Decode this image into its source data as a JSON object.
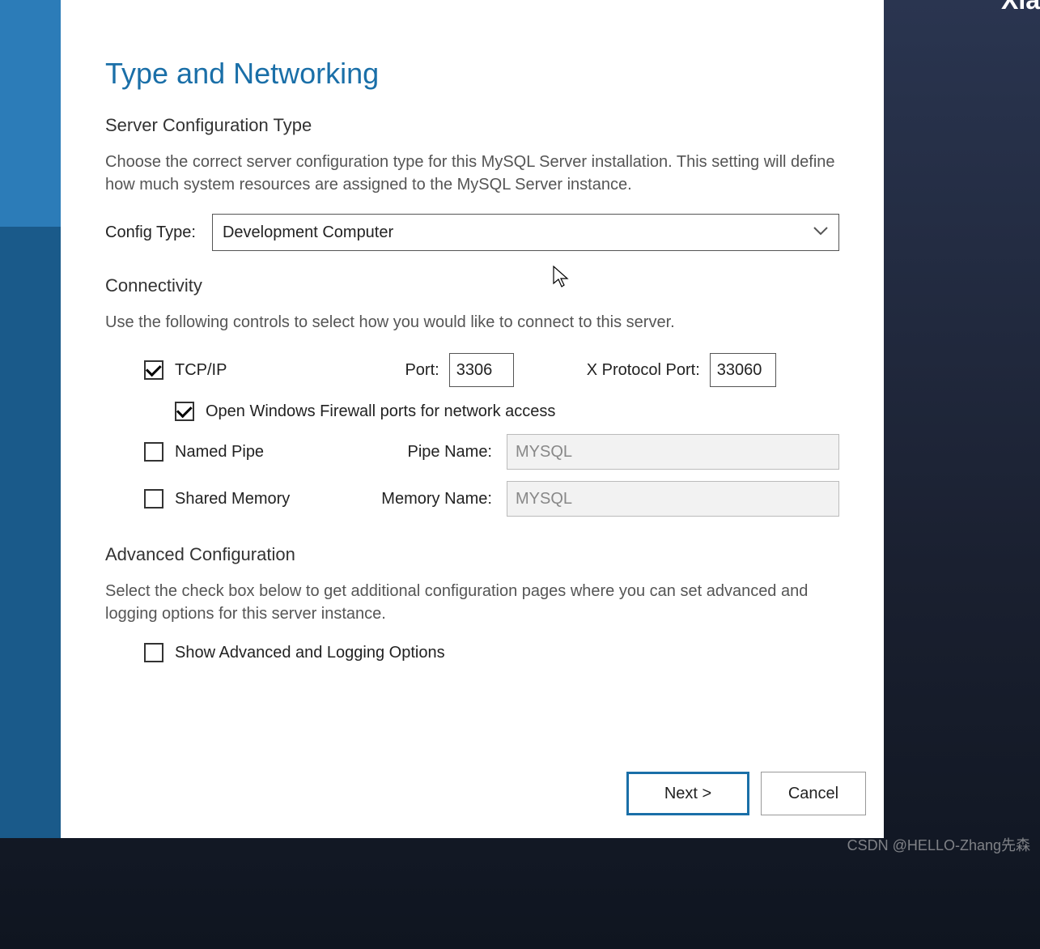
{
  "page": {
    "title": "Type and Networking"
  },
  "server_config": {
    "title": "Server Configuration Type",
    "desc": "Choose the correct server configuration type for this MySQL Server installation. This setting will define how much system resources are assigned to the MySQL Server instance.",
    "label": "Config Type:",
    "selected": "Development Computer"
  },
  "connectivity": {
    "title": "Connectivity",
    "desc": "Use the following controls to select how you would like to connect to this server.",
    "tcpip": {
      "label": "TCP/IP",
      "checked": true,
      "port_label": "Port:",
      "port_value": "3306",
      "xport_label": "X Protocol Port:",
      "xport_value": "33060"
    },
    "firewall": {
      "label": "Open Windows Firewall ports for network access",
      "checked": true
    },
    "named_pipe": {
      "label": "Named Pipe",
      "checked": false,
      "name_label": "Pipe Name:",
      "name_value": "MYSQL"
    },
    "shared_memory": {
      "label": "Shared Memory",
      "checked": false,
      "name_label": "Memory Name:",
      "name_value": "MYSQL"
    }
  },
  "advanced": {
    "title": "Advanced Configuration",
    "desc": "Select the check box below to get additional configuration pages where you can set advanced and logging options for this server instance.",
    "show": {
      "label": "Show Advanced and Logging Options",
      "checked": false
    }
  },
  "footer": {
    "next": "Next >",
    "cancel": "Cancel"
  },
  "watermark": "CSDN @HELLO-Zhang先森"
}
